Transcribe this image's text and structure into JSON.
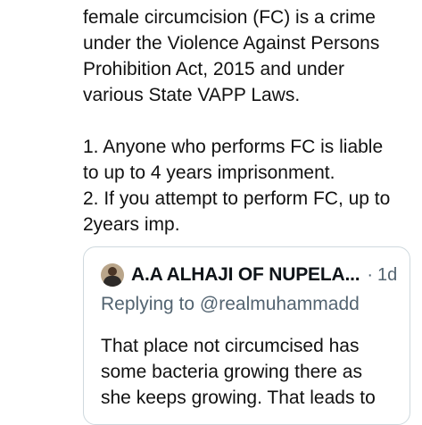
{
  "tweet": {
    "lines": [
      "female circumcision (FC) is a crime",
      "under the Violence Against Persons",
      "Prohibition Act, 2015 and under",
      "various State VAPP Laws.",
      "1. Anyone who performs FC is liable",
      "to up to 4 years imprisonment.",
      "2. If you attempt to perform FC, up to",
      "2years imp."
    ]
  },
  "quoted_tweet": {
    "author_name": "A.A ALHAJI OF NUPELA...",
    "separator": "·",
    "timestamp": "1d",
    "replying_prefix": "Replying to",
    "replying_handle": "@realmuhammadd",
    "lines": [
      "That place not circumcised has",
      "some bacteria growing there as",
      "she keeps growing. That leads to"
    ]
  }
}
